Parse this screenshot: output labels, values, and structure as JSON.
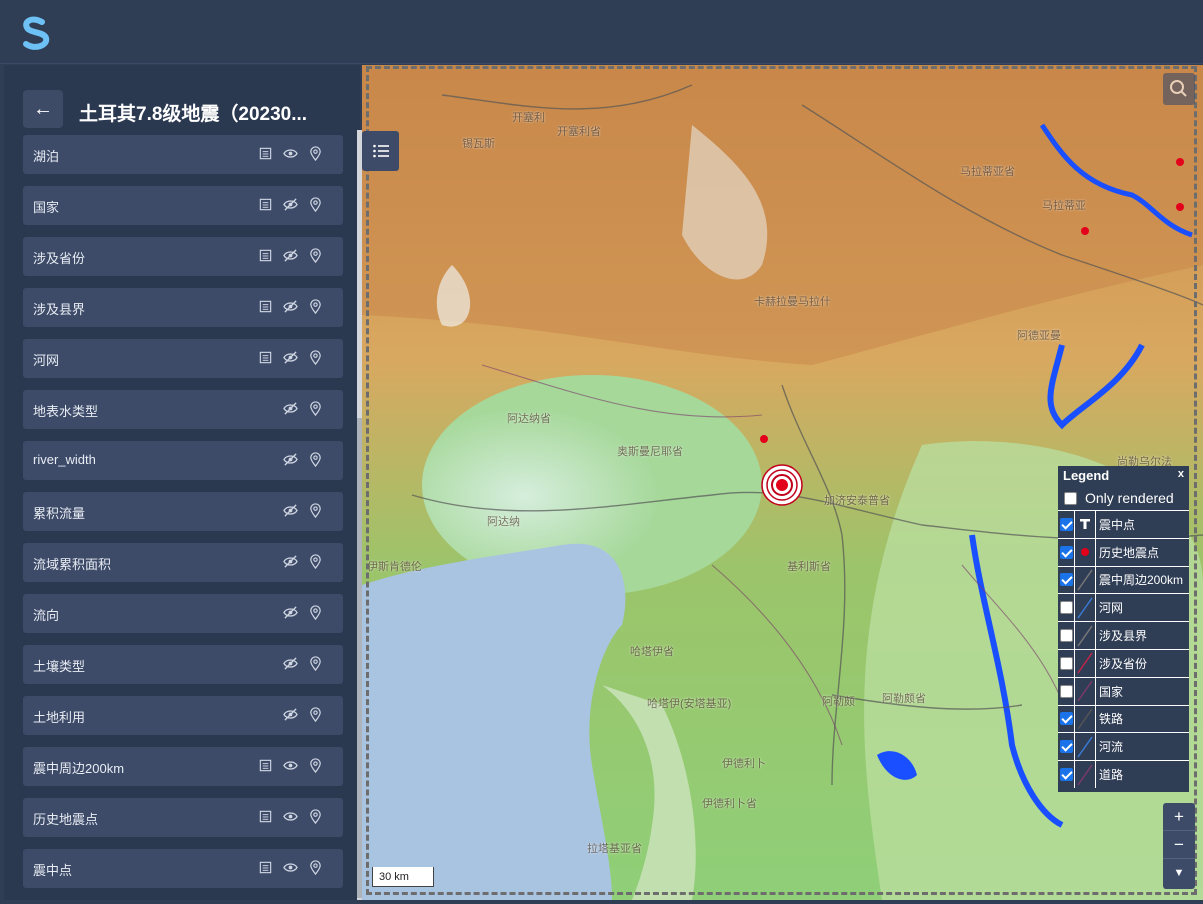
{
  "app": {
    "logo": "s-logo-icon"
  },
  "sidebar": {
    "title": "土耳其7.8级地震（20230...",
    "back": "back-arrow-icon",
    "layers": [
      {
        "label": "湖泊",
        "table": true,
        "visible": true
      },
      {
        "label": "国家",
        "table": true,
        "visible": false
      },
      {
        "label": "涉及省份",
        "table": true,
        "visible": false
      },
      {
        "label": "涉及县界",
        "table": true,
        "visible": false
      },
      {
        "label": "河网",
        "table": true,
        "visible": false
      },
      {
        "label": "地表水类型",
        "table": false,
        "visible": false
      },
      {
        "label": "river_width",
        "table": false,
        "visible": false
      },
      {
        "label": "累积流量",
        "table": false,
        "visible": false
      },
      {
        "label": "流域累积面积",
        "table": false,
        "visible": false
      },
      {
        "label": "流向",
        "table": false,
        "visible": false
      },
      {
        "label": "土壤类型",
        "table": false,
        "visible": false
      },
      {
        "label": "土地利用",
        "table": false,
        "visible": false
      },
      {
        "label": "震中周边200km",
        "table": true,
        "visible": true
      },
      {
        "label": "历史地震点",
        "table": true,
        "visible": true
      },
      {
        "label": "震中点",
        "table": true,
        "visible": true
      }
    ]
  },
  "map": {
    "scale": "30 km",
    "labels": [
      {
        "text": "开塞利",
        "name": "label-kayseri-1"
      },
      {
        "text": "开塞利省",
        "name": "label-kayseri-2"
      },
      {
        "text": "锡瓦斯",
        "name": "label-sivas-1"
      },
      {
        "text": "马拉蒂亚省",
        "name": "label-malatya-1"
      },
      {
        "text": "马拉蒂亚",
        "name": "label-malatya-2"
      },
      {
        "text": "阿德亚曼",
        "name": "label-adiyaman"
      },
      {
        "text": "卡赫拉曼马拉什",
        "name": "label-kahramanmaras"
      },
      {
        "text": "阿达纳省",
        "name": "label-adana-province"
      },
      {
        "text": "奥斯曼尼耶省",
        "name": "label-osmaniye"
      },
      {
        "text": "加济安泰普省",
        "name": "label-gaziantep"
      },
      {
        "text": "尚勒乌尔法",
        "name": "label-sanliurfa"
      },
      {
        "text": "阿达纳",
        "name": "label-adana"
      },
      {
        "text": "伊斯肯德伦",
        "name": "label-iskenderun"
      },
      {
        "text": "基利斯省",
        "name": "label-kilis"
      },
      {
        "text": "哈塔伊省",
        "name": "label-hatay"
      },
      {
        "text": "阿勒颇",
        "name": "label-aleppo"
      },
      {
        "text": "阿勒颇省",
        "name": "label-aleppo-province"
      },
      {
        "text": "哈塔伊(安塔基亚)",
        "name": "label-antakya"
      },
      {
        "text": "伊德利卜",
        "name": "label-idlib"
      },
      {
        "text": "伊德利卜省",
        "name": "label-idlib-province"
      },
      {
        "text": "拉塔基亚省",
        "name": "label-latakia"
      }
    ]
  },
  "legend": {
    "title": "Legend",
    "close": "x",
    "only_rendered": "Only rendered",
    "items": [
      {
        "label": "震中点",
        "checked": true,
        "symbol": "text",
        "color": "#000000"
      },
      {
        "label": "历史地震点",
        "checked": true,
        "symbol": "dot",
        "color": "#e3001b"
      },
      {
        "label": "震中周边200km",
        "checked": true,
        "symbol": "line",
        "color": "#777777"
      },
      {
        "label": "河网",
        "checked": false,
        "symbol": "line",
        "color": "#3a7bd5"
      },
      {
        "label": "涉及县界",
        "checked": false,
        "symbol": "line",
        "color": "#777777"
      },
      {
        "label": "涉及省份",
        "checked": false,
        "symbol": "line",
        "color": "#c0264a"
      },
      {
        "label": "国家",
        "checked": false,
        "symbol": "line",
        "color": "#7a3a6a"
      },
      {
        "label": "铁路",
        "checked": true,
        "symbol": "line",
        "color": "#555555"
      },
      {
        "label": "河流",
        "checked": true,
        "symbol": "line",
        "color": "#3a7bd5"
      },
      {
        "label": "道路",
        "checked": true,
        "symbol": "line",
        "color": "#7a3a6a"
      }
    ]
  }
}
